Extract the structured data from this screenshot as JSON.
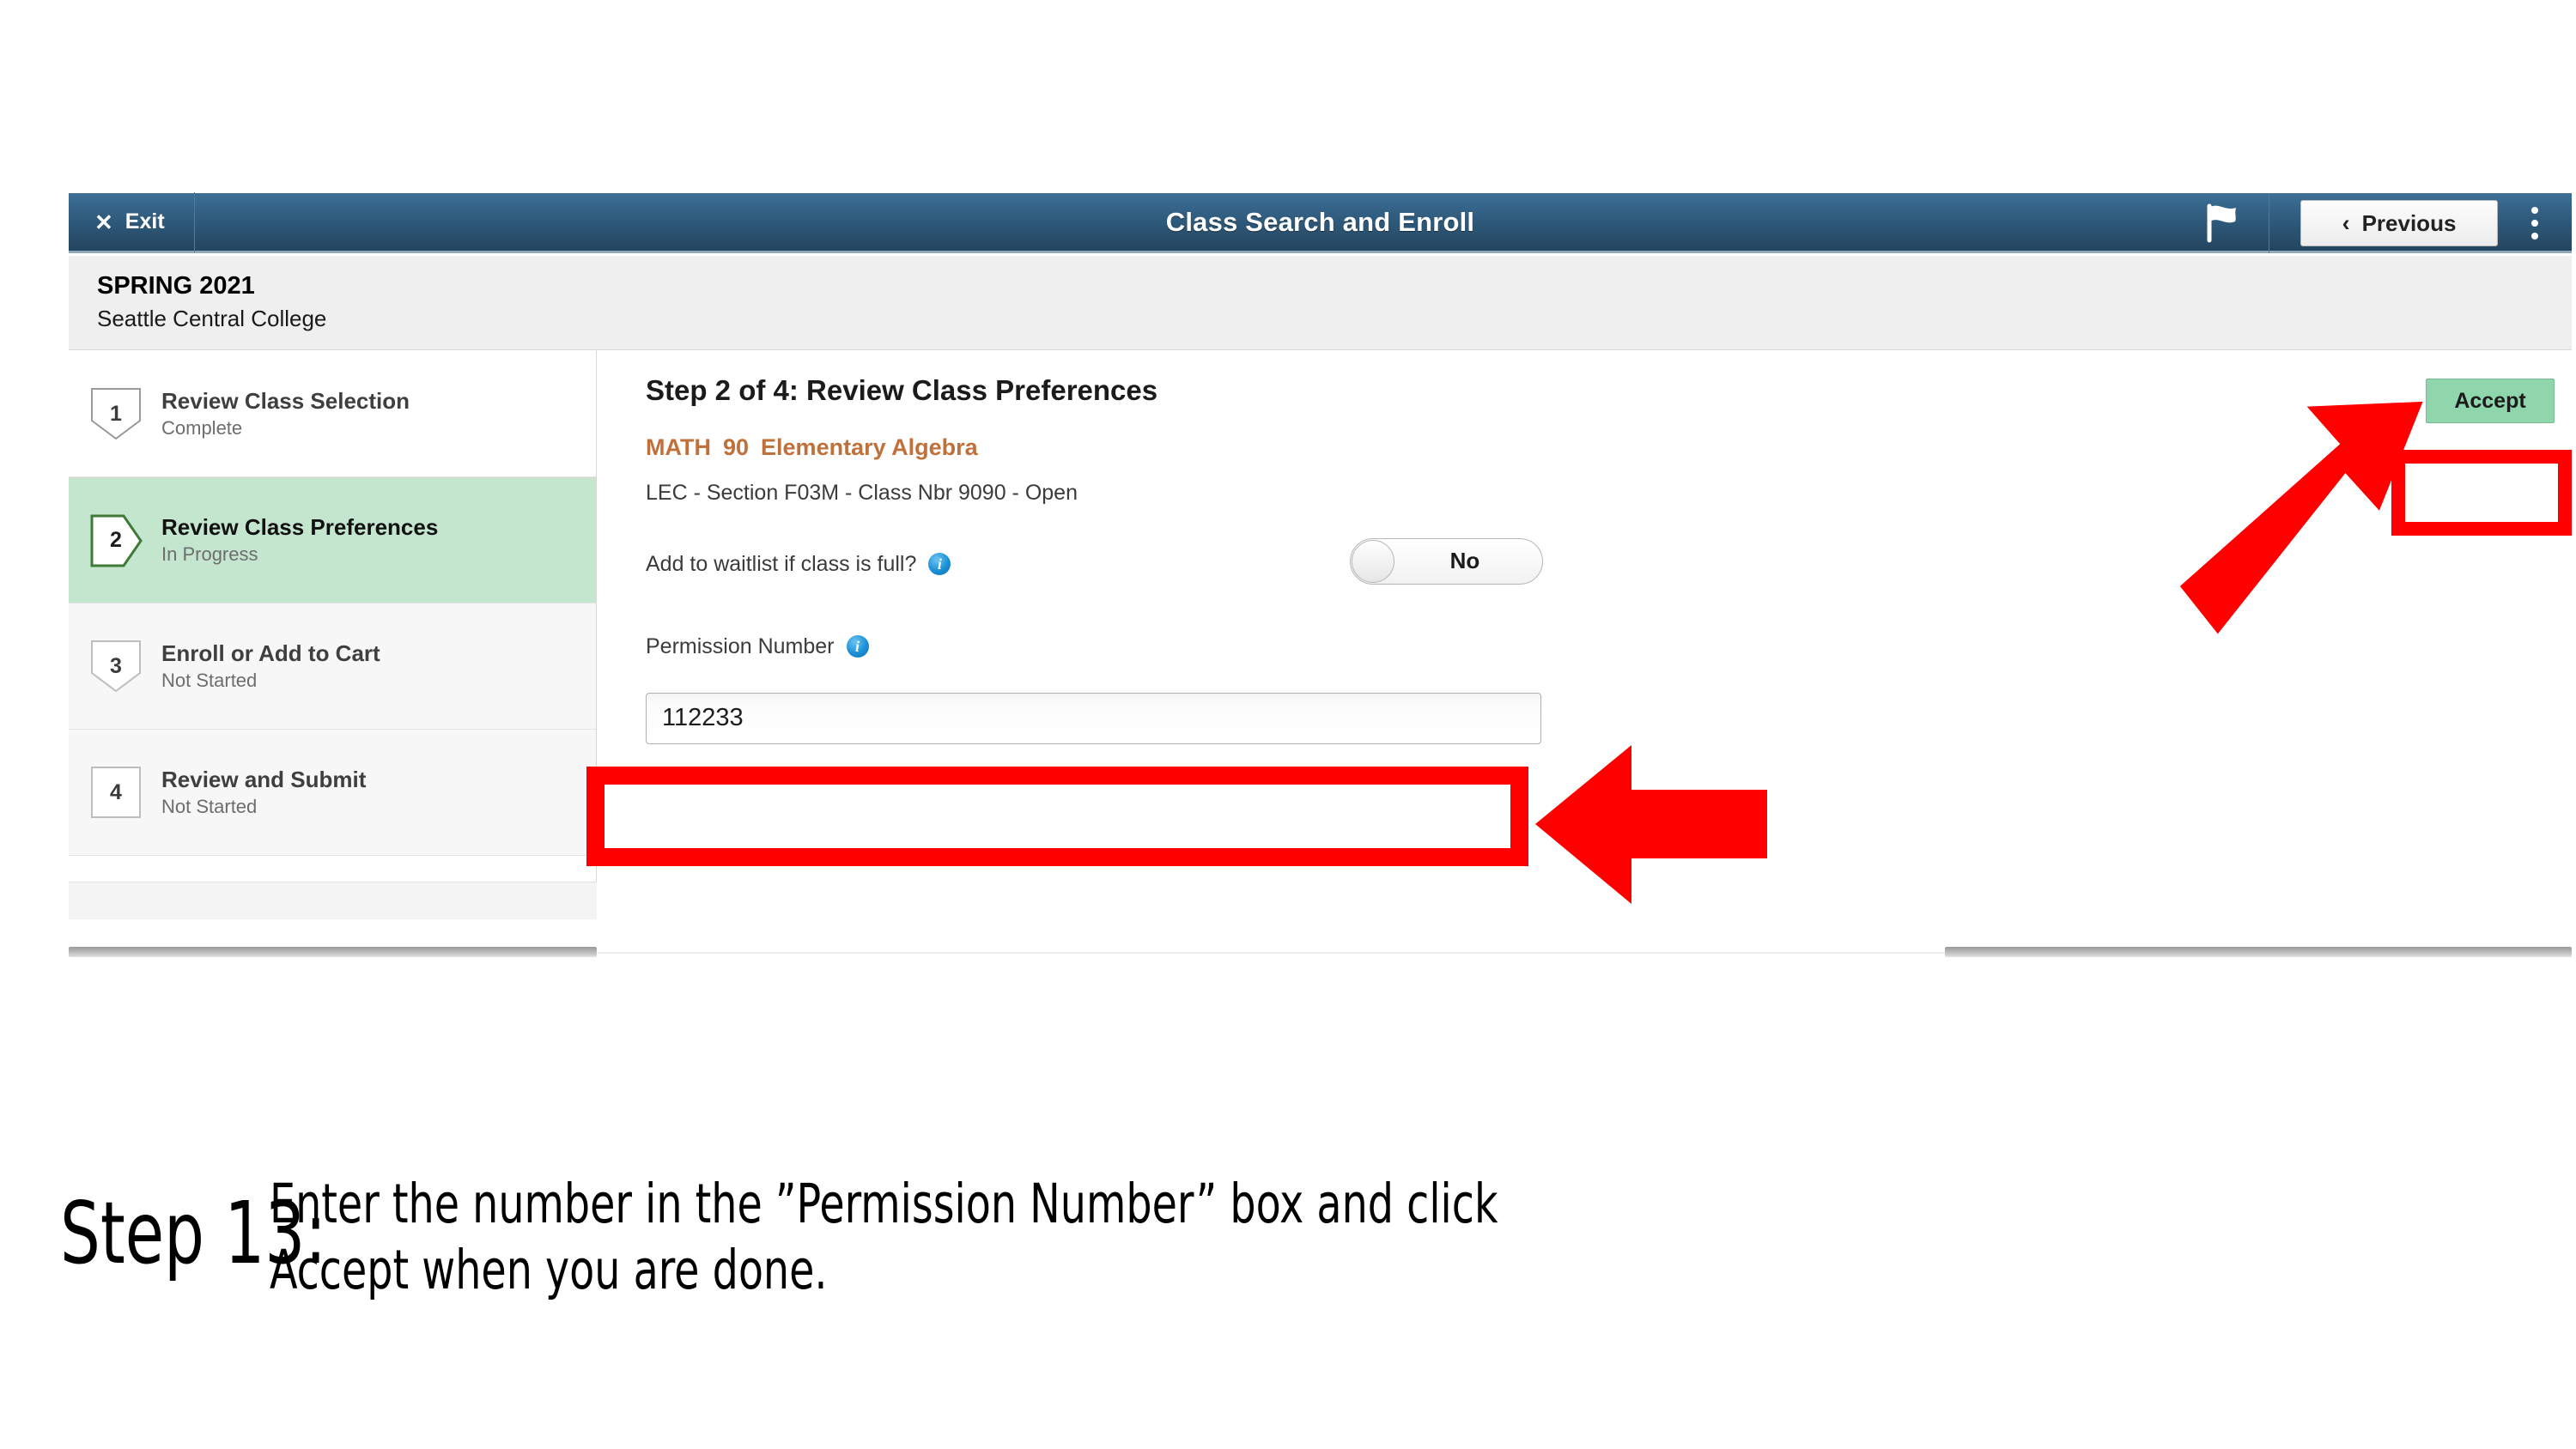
{
  "screenshot": {
    "header": {
      "exit_label": "Exit",
      "exit_icon": "close-x-icon",
      "title": "Class Search and Enroll",
      "flag_icon": "flag-icon",
      "previous_label": "Previous",
      "previous_chevron": "‹",
      "menu_icon": "kebab-menu-icon"
    },
    "term": {
      "term_name": "SPRING 2021",
      "institution": "Seattle Central College"
    },
    "steps": [
      {
        "number": "1",
        "name": "Review Class Selection",
        "status": "Complete"
      },
      {
        "number": "2",
        "name": "Review Class Preferences",
        "status": "In Progress"
      },
      {
        "number": "3",
        "name": "Enroll or Add to Cart",
        "status": "Not Started"
      },
      {
        "number": "4",
        "name": "Review and Submit",
        "status": "Not Started"
      }
    ],
    "main": {
      "heading": "Step 2 of 4: Review Class Preferences",
      "course_subject": "MATH",
      "course_number": "90",
      "course_title": "Elementary Algebra",
      "section_line": "LEC - Section F03M - Class Nbr 9090 - Open",
      "waitlist_label": "Add to waitlist if class is full?",
      "waitlist_info_icon": "info-icon",
      "waitlist_value": "No",
      "permission_label": "Permission Number",
      "permission_info_icon": "info-icon",
      "permission_value": "112233",
      "accept_label": "Accept"
    }
  },
  "annotations": {
    "arrow_color": "#fe0000",
    "highlight_color": "#fe0000",
    "accept_arrow": "arrow-up-right-icon",
    "input_arrow": "arrow-left-icon"
  },
  "caption": {
    "step_label": "Step 13:",
    "line1_before": "Enter the number in the ”Permission Number” box and click",
    "line2": "Accept when you are done."
  },
  "colors": {
    "header_blue": "#2f5b7d",
    "active_step_green": "#c5e6ce",
    "accept_green": "#8fd6ad",
    "course_orange": "#c0703a",
    "annotation_red": "#fe0000"
  }
}
